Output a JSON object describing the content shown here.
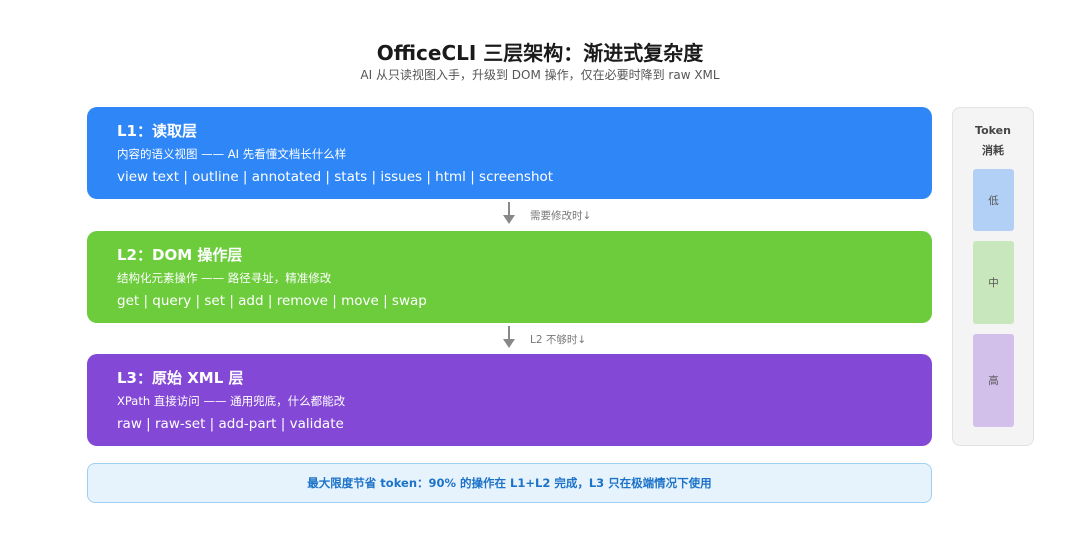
{
  "header": {
    "title": "OfficeCLI 三层架构：渐进式复杂度",
    "subtitle": "AI 从只读视图入手，升级到 DOM 操作，仅在必要时降到 raw XML"
  },
  "layers": [
    {
      "title": "L1：读取层",
      "description": "内容的语义视图 —— AI 先看懂文档长什么样",
      "commands": "view text | outline | annotated | stats | issues | html | screenshot",
      "color": "#2f86f6"
    },
    {
      "title": "L2：DOM 操作层",
      "description": "结构化元素操作 —— 路径寻址，精准修改",
      "commands": "get | query | set | add | remove | move | swap",
      "color": "#6ccc3c"
    },
    {
      "title": "L3：原始 XML 层",
      "description": "XPath 直接访问 —— 通用兜底，什么都能改",
      "commands": "raw | raw-set | add-part | validate",
      "color": "#8448d6"
    }
  ],
  "transitions": [
    {
      "label": "需要修改时↓"
    },
    {
      "label": "L2 不够时↓"
    }
  ],
  "footer": {
    "text": "最大限度节省 token：90% 的操作在 L1+L2 完成，L3 只在极端情况下使用"
  },
  "token_panel": {
    "title_line1": "Token",
    "title_line2": "消耗",
    "levels": [
      "低",
      "中",
      "高"
    ]
  }
}
